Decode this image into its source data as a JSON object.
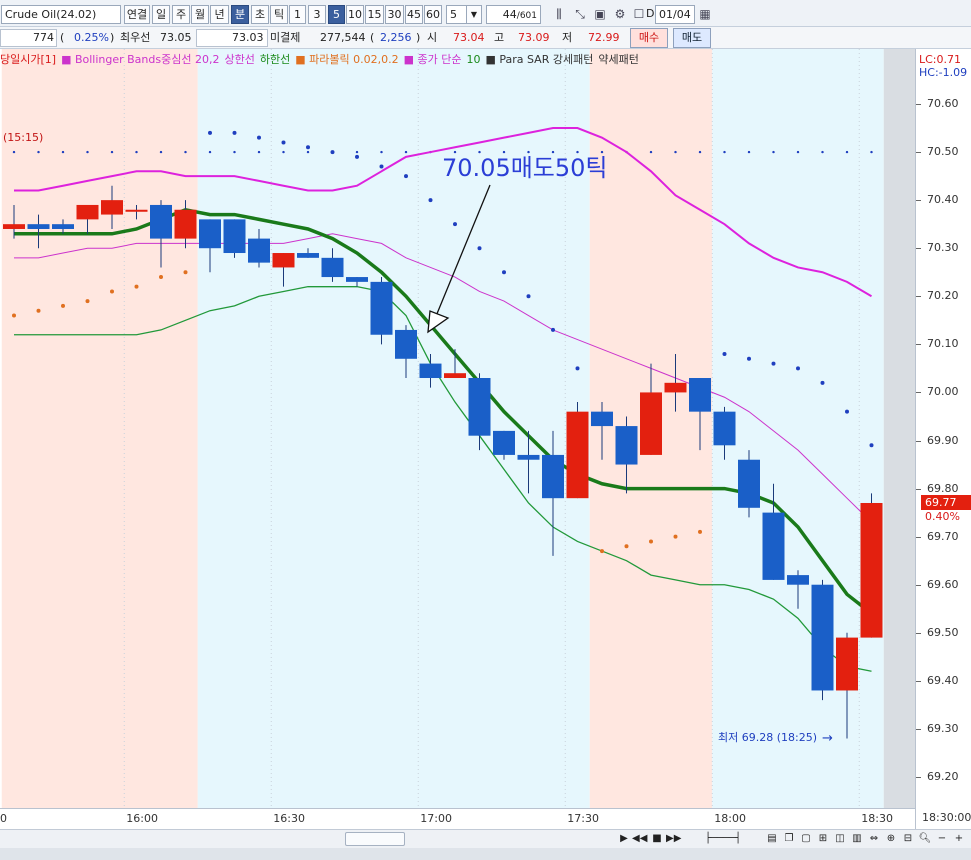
{
  "toolbar": {
    "symbol": "Crude Oil(24.02)",
    "buttons": [
      "연결",
      "일",
      "주",
      "월",
      "년",
      "분",
      "초",
      "틱",
      "1",
      "3",
      "5",
      "10",
      "15",
      "30",
      "45",
      "60"
    ],
    "selected_buttons": [
      "분",
      "5"
    ],
    "interval_value": "5",
    "count_value": "44",
    "count_total": "/601",
    "date_value": "01/04",
    "icons": [
      "candle-settings-icon",
      "cursor-icon",
      "save-icon",
      "gear-icon",
      "checkbox-icon",
      "calendar-icon"
    ],
    "checkbox_label": "D"
  },
  "quote": {
    "volume": "774",
    "open_paren": "(",
    "change_pct": "0.25%",
    "close_paren": ")",
    "best_ask_label": "최우선",
    "best_ask": "73.05",
    "best_bid": "73.03",
    "open_interest_label": "미결제",
    "open_interest": "277,544",
    "oi_change": "2,256",
    "open_label": "시",
    "open_value": "73.04",
    "high_label": "고",
    "high_value": "73.09",
    "low_label": "저",
    "low_value": "72.99",
    "buy_button": "매수",
    "sell_button": "매도"
  },
  "legend": {
    "items": [
      {
        "text": "당일시가[1]",
        "color": "#d91a1a"
      },
      {
        "text": "■ Bollinger Bands중심선 20,2",
        "color": "#cc33cc"
      },
      {
        "text": "상한선",
        "color": "#cc33cc"
      },
      {
        "text": "하한선",
        "color": "#1a8a1a"
      },
      {
        "text": "■ 파라볼릭 0.02,0.2",
        "color": "#e07020"
      },
      {
        "text": "■ 종가 단순",
        "color": "#cc33cc"
      },
      {
        "text": "10",
        "color": "#1a8a1a"
      },
      {
        "text": "■ Para SAR 강세패턴",
        "color": "#333333"
      },
      {
        "text": "약세패턴",
        "color": "#333333"
      }
    ],
    "lc": "LC:0.71",
    "hc": "HC:-1.09"
  },
  "annotations": {
    "time_label": "(15:15)",
    "signal_text": "70.05매도50틱",
    "low_note": "최저 69.28 (18:25)",
    "low_arrow": "→"
  },
  "price_tag": {
    "value": "69.77",
    "pct": "0.40%"
  },
  "chart_data": {
    "type": "candlestick",
    "title": "",
    "y_ticks": [
      "70.60",
      "70.50",
      "70.40",
      "70.30",
      "70.20",
      "70.10",
      "70.00",
      "69.90",
      "69.80",
      "69.70",
      "69.60",
      "69.50",
      "69.40",
      "69.30",
      "69.20"
    ],
    "y_range": [
      69.16,
      70.68
    ],
    "x_ticks": [
      {
        "label": "16:00",
        "index": 4.5
      },
      {
        "label": "16:30",
        "index": 10.5
      },
      {
        "label": "17:00",
        "index": 16.5
      },
      {
        "label": "17:30",
        "index": 22.5
      },
      {
        "label": "18:00",
        "index": 28.5
      },
      {
        "label": "18:30",
        "index": 34.5
      },
      {
        "label": "18:30:00",
        "index": 38.8
      }
    ],
    "x_left_edge_label": "0",
    "sessions": [
      {
        "from": -0.5,
        "to": 7.5,
        "color": "#ffe7e0"
      },
      {
        "from": 7.5,
        "to": 23.5,
        "color": "#e6f7fd"
      },
      {
        "from": 23.5,
        "to": 28.5,
        "color": "#ffe7e0"
      },
      {
        "from": 28.5,
        "to": 35.5,
        "color": "#e6f7fd"
      }
    ],
    "candles": [
      {
        "o": 70.34,
        "h": 70.39,
        "l": 70.32,
        "c": 70.35
      },
      {
        "o": 70.35,
        "h": 70.37,
        "l": 70.3,
        "c": 70.34
      },
      {
        "o": 70.35,
        "h": 70.36,
        "l": 70.33,
        "c": 70.34
      },
      {
        "o": 70.36,
        "h": 70.39,
        "l": 70.33,
        "c": 70.39
      },
      {
        "o": 70.37,
        "h": 70.43,
        "l": 70.34,
        "c": 70.4
      },
      {
        "o": 70.38,
        "h": 70.39,
        "l": 70.36,
        "c": 70.38
      },
      {
        "o": 70.39,
        "h": 70.4,
        "l": 70.26,
        "c": 70.32
      },
      {
        "o": 70.32,
        "h": 70.4,
        "l": 70.3,
        "c": 70.38
      },
      {
        "o": 70.36,
        "h": 70.36,
        "l": 70.25,
        "c": 70.3
      },
      {
        "o": 70.36,
        "h": 70.36,
        "l": 70.28,
        "c": 70.29
      },
      {
        "o": 70.32,
        "h": 70.34,
        "l": 70.26,
        "c": 70.27
      },
      {
        "o": 70.26,
        "h": 70.29,
        "l": 70.22,
        "c": 70.29
      },
      {
        "o": 70.29,
        "h": 70.3,
        "l": 70.28,
        "c": 70.28
      },
      {
        "o": 70.28,
        "h": 70.3,
        "l": 70.23,
        "c": 70.24
      },
      {
        "o": 70.24,
        "h": 70.24,
        "l": 70.22,
        "c": 70.23
      },
      {
        "o": 70.23,
        "h": 70.24,
        "l": 70.1,
        "c": 70.12
      },
      {
        "o": 70.13,
        "h": 70.14,
        "l": 70.03,
        "c": 70.07
      },
      {
        "o": 70.06,
        "h": 70.08,
        "l": 70.01,
        "c": 70.03
      },
      {
        "o": 70.03,
        "h": 70.09,
        "l": 70.03,
        "c": 70.04
      },
      {
        "o": 70.03,
        "h": 70.04,
        "l": 69.88,
        "c": 69.91
      },
      {
        "o": 69.92,
        "h": 69.92,
        "l": 69.86,
        "c": 69.87
      },
      {
        "o": 69.87,
        "h": 69.92,
        "l": 69.79,
        "c": 69.86
      },
      {
        "o": 69.87,
        "h": 69.92,
        "l": 69.66,
        "c": 69.78
      },
      {
        "o": 69.78,
        "h": 69.98,
        "l": 69.78,
        "c": 69.96
      },
      {
        "o": 69.96,
        "h": 69.98,
        "l": 69.86,
        "c": 69.93
      },
      {
        "o": 69.93,
        "h": 69.95,
        "l": 69.79,
        "c": 69.85
      },
      {
        "o": 69.87,
        "h": 70.06,
        "l": 69.87,
        "c": 70.0
      },
      {
        "o": 70.0,
        "h": 70.08,
        "l": 69.96,
        "c": 70.02
      },
      {
        "o": 70.03,
        "h": 70.03,
        "l": 69.88,
        "c": 69.96
      },
      {
        "o": 69.96,
        "h": 69.97,
        "l": 69.86,
        "c": 69.89
      },
      {
        "o": 69.86,
        "h": 69.88,
        "l": 69.74,
        "c": 69.76
      },
      {
        "o": 69.75,
        "h": 69.81,
        "l": 69.61,
        "c": 69.61
      },
      {
        "o": 69.62,
        "h": 69.63,
        "l": 69.55,
        "c": 69.6
      },
      {
        "o": 69.6,
        "h": 69.61,
        "l": 69.36,
        "c": 69.38
      },
      {
        "o": 69.38,
        "h": 69.5,
        "l": 69.28,
        "c": 69.49
      },
      {
        "o": 69.49,
        "h": 69.79,
        "l": 69.49,
        "c": 69.77
      }
    ],
    "ma10": [
      70.33,
      70.33,
      70.33,
      70.33,
      70.33,
      70.34,
      70.36,
      70.38,
      70.37,
      70.37,
      70.36,
      70.35,
      70.34,
      70.32,
      70.29,
      70.25,
      70.2,
      70.14,
      70.08,
      70.02,
      69.96,
      69.91,
      69.86,
      69.83,
      69.81,
      69.8,
      69.8,
      69.8,
      69.8,
      69.8,
      69.79,
      69.77,
      69.72,
      69.65,
      69.58,
      69.54
    ],
    "mid": [
      70.28,
      70.28,
      70.29,
      70.3,
      70.3,
      70.31,
      70.31,
      70.31,
      70.31,
      70.31,
      70.31,
      70.31,
      70.32,
      70.33,
      70.32,
      70.31,
      70.28,
      70.26,
      70.24,
      70.21,
      70.19,
      70.16,
      70.13,
      70.11,
      70.09,
      70.07,
      70.05,
      70.03,
      70.01,
      69.99,
      69.96,
      69.92,
      69.88,
      69.83,
      69.78,
      69.73
    ],
    "upper": [
      70.42,
      70.42,
      70.43,
      70.44,
      70.45,
      70.46,
      70.46,
      70.45,
      70.45,
      70.45,
      70.44,
      70.43,
      70.42,
      70.42,
      70.43,
      70.46,
      70.49,
      70.5,
      70.51,
      70.52,
      70.53,
      70.54,
      70.55,
      70.55,
      70.53,
      70.5,
      70.46,
      70.41,
      70.38,
      70.35,
      70.31,
      70.28,
      70.26,
      70.25,
      70.23,
      70.2
    ],
    "lower": [
      70.12,
      70.12,
      70.12,
      70.12,
      70.12,
      70.12,
      70.13,
      70.15,
      70.17,
      70.18,
      70.2,
      70.21,
      70.22,
      70.22,
      70.22,
      70.21,
      70.16,
      70.06,
      69.98,
      69.91,
      69.84,
      69.77,
      69.72,
      69.69,
      69.67,
      69.65,
      69.62,
      69.61,
      69.6,
      69.6,
      69.59,
      69.57,
      69.53,
      69.47,
      69.43,
      69.42
    ],
    "sar": [
      {
        "i": 0,
        "v": 70.16,
        "t": "bull"
      },
      {
        "i": 1,
        "v": 70.17,
        "t": "bull"
      },
      {
        "i": 2,
        "v": 70.18,
        "t": "bull"
      },
      {
        "i": 3,
        "v": 70.19,
        "t": "bull"
      },
      {
        "i": 4,
        "v": 70.21,
        "t": "bull"
      },
      {
        "i": 5,
        "v": 70.22,
        "t": "bull"
      },
      {
        "i": 6,
        "v": 70.24,
        "t": "bull"
      },
      {
        "i": 7,
        "v": 70.25,
        "t": "bull"
      },
      {
        "i": 8,
        "v": 70.54,
        "t": "bear"
      },
      {
        "i": 9,
        "v": 70.54,
        "t": "bear"
      },
      {
        "i": 10,
        "v": 70.53,
        "t": "bear"
      },
      {
        "i": 11,
        "v": 70.52,
        "t": "bear"
      },
      {
        "i": 12,
        "v": 70.51,
        "t": "bear"
      },
      {
        "i": 13,
        "v": 70.5,
        "t": "bear"
      },
      {
        "i": 14,
        "v": 70.49,
        "t": "bear"
      },
      {
        "i": 15,
        "v": 70.47,
        "t": "bear"
      },
      {
        "i": 16,
        "v": 70.45,
        "t": "bear"
      },
      {
        "i": 17,
        "v": 70.4,
        "t": "bear"
      },
      {
        "i": 18,
        "v": 70.35,
        "t": "bear"
      },
      {
        "i": 19,
        "v": 70.3,
        "t": "bear"
      },
      {
        "i": 20,
        "v": 70.25,
        "t": "bear"
      },
      {
        "i": 21,
        "v": 70.2,
        "t": "bear"
      },
      {
        "i": 22,
        "v": 70.13,
        "t": "bear"
      },
      {
        "i": 23,
        "v": 70.05,
        "t": "bear"
      },
      {
        "i": 24,
        "v": 69.67,
        "t": "bull"
      },
      {
        "i": 25,
        "v": 69.68,
        "t": "bull"
      },
      {
        "i": 26,
        "v": 69.69,
        "t": "bull"
      },
      {
        "i": 27,
        "v": 69.7,
        "t": "bull"
      },
      {
        "i": 28,
        "v": 69.71,
        "t": "bull"
      },
      {
        "i": 29,
        "v": 70.08,
        "t": "bear"
      },
      {
        "i": 30,
        "v": 70.07,
        "t": "bear"
      },
      {
        "i": 31,
        "v": 70.06,
        "t": "bear"
      },
      {
        "i": 32,
        "v": 70.05,
        "t": "bear"
      },
      {
        "i": 33,
        "v": 70.02,
        "t": "bear"
      },
      {
        "i": 34,
        "v": 69.96,
        "t": "bear"
      },
      {
        "i": 35,
        "v": 69.89,
        "t": "bear"
      }
    ],
    "day_open": 70.5,
    "colors": {
      "up": "#e3200f",
      "down": "#1a5fc8",
      "ma10": "#1a7a1a",
      "mid": "#cc33cc",
      "upper": "#dd22dd",
      "lower": "#22993a",
      "sar_bull": "#e07020",
      "sar_bear": "#1f3fbf",
      "day_open": "#1f3fbf"
    }
  }
}
